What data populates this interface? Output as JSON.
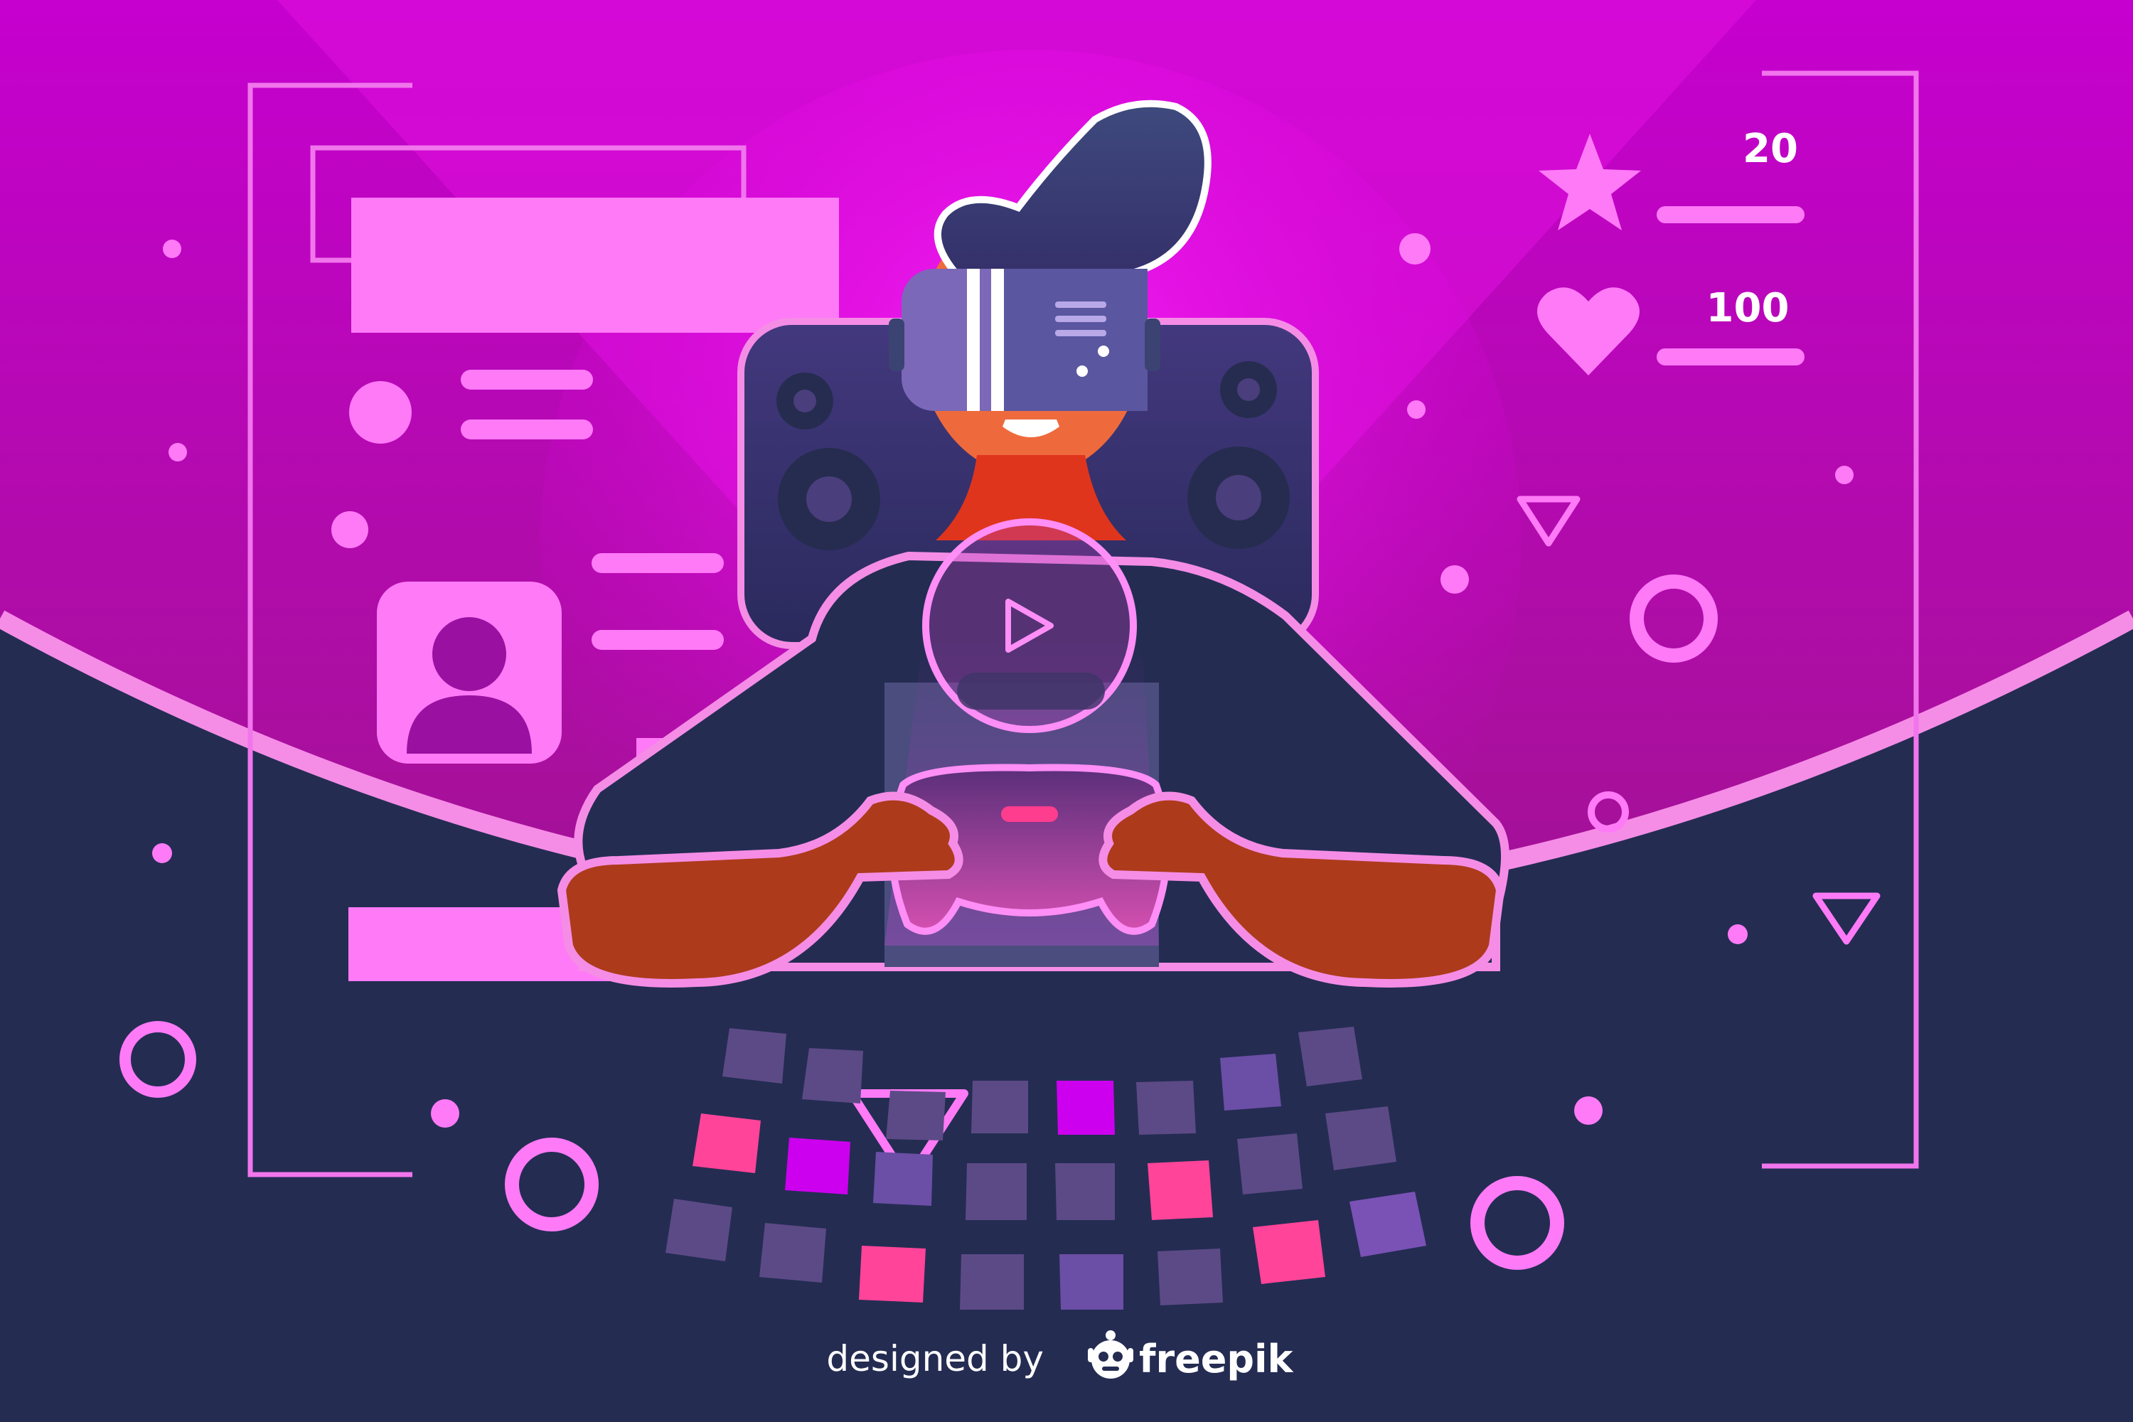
{
  "hud": {
    "star_score": "20",
    "heart_score": "100"
  },
  "credit": {
    "prefix": "designed by",
    "brand": "freepik"
  },
  "icons": {
    "star": "star-icon",
    "heart": "heart-icon",
    "play": "play-icon",
    "user": "user-icon",
    "freepik_logo": "freepik-logo-icon"
  },
  "colors": {
    "background_top": "#d100d4",
    "background_dark": "#242c52",
    "accent_pink": "#ff7af7",
    "tile_pink": "#ff4499",
    "tile_magenta": "#cc00ee",
    "tile_purple": "#5c4a86",
    "skin": "#ad3a1b",
    "hair": "#3b4372"
  }
}
